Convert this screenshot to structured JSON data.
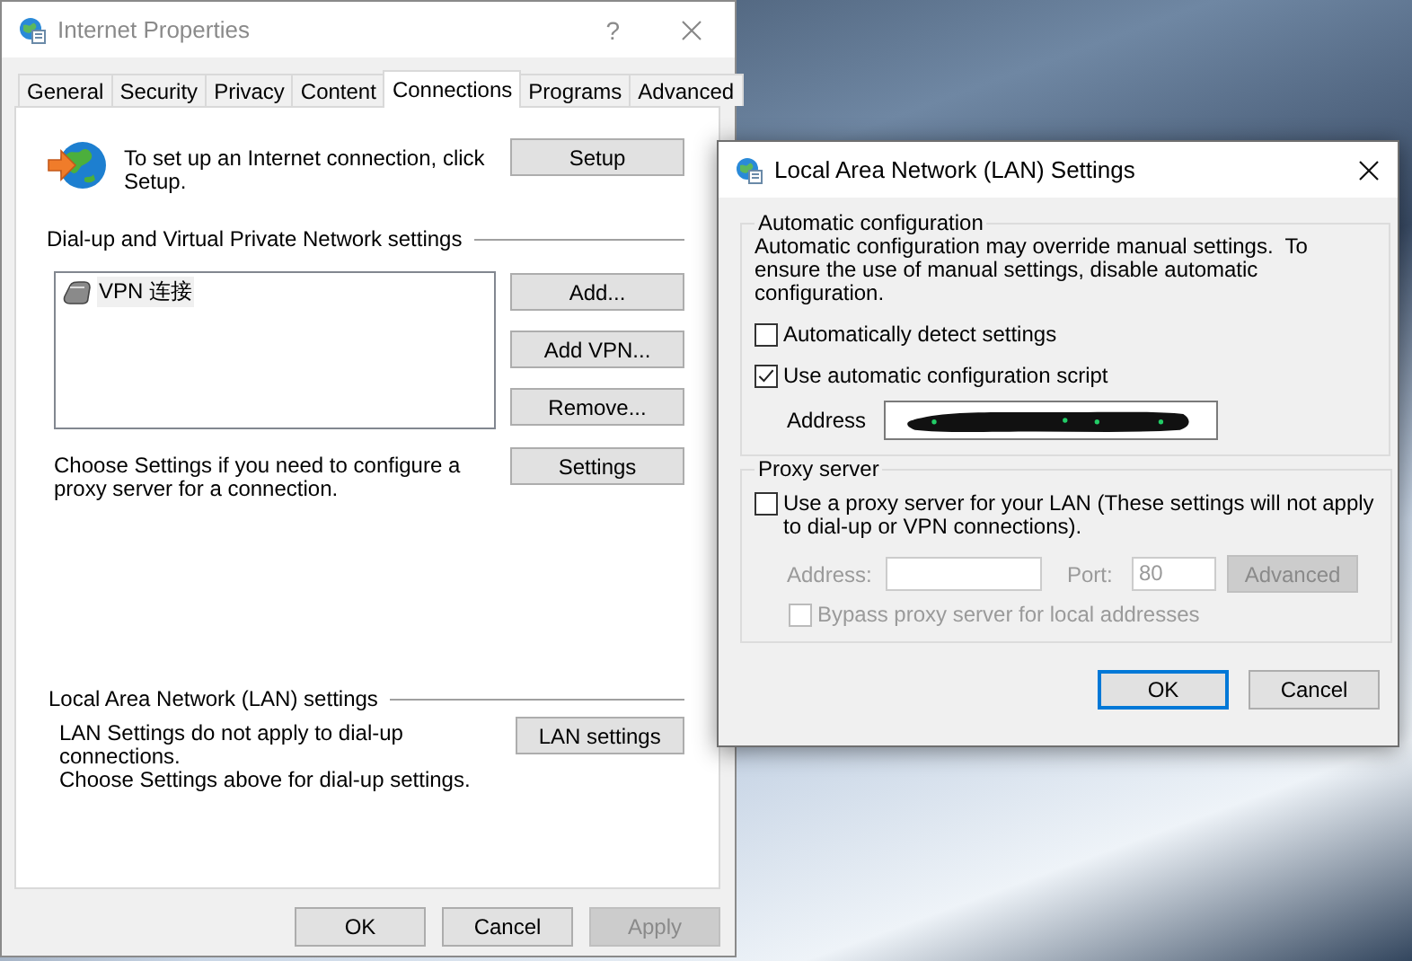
{
  "internet_properties": {
    "title": "Internet Properties",
    "help": "?",
    "tabs": [
      {
        "label": "General",
        "selected": false
      },
      {
        "label": "Security",
        "selected": false
      },
      {
        "label": "Privacy",
        "selected": false
      },
      {
        "label": "Content",
        "selected": false
      },
      {
        "label": "Connections",
        "selected": true
      },
      {
        "label": "Programs",
        "selected": false
      },
      {
        "label": "Advanced",
        "selected": false
      }
    ],
    "setup": {
      "text": "To set up an Internet connection, click Setup.",
      "button": "Setup"
    },
    "dialup": {
      "heading": "Dial-up and Virtual Private Network settings",
      "connections": [
        {
          "name": "VPN 连接",
          "selected": true
        }
      ],
      "buttons": [
        "Add...",
        "Add VPN...",
        "Remove..."
      ],
      "proxy_note": "Choose Settings if you need to configure a proxy server for a connection.",
      "settings_button": "Settings"
    },
    "lan": {
      "heading": "Local Area Network (LAN) settings",
      "note_lines": [
        "LAN Settings do not apply to dial-up connections.",
        "Choose Settings above for dial-up settings."
      ],
      "button": "LAN settings"
    },
    "footer_buttons": [
      {
        "label": "OK",
        "disabled": false
      },
      {
        "label": "Cancel",
        "disabled": false
      },
      {
        "label": "Apply",
        "disabled": true
      }
    ]
  },
  "lan_dialog": {
    "title": "Local Area Network (LAN) Settings",
    "auto_config": {
      "heading": "Automatic configuration",
      "description": "Automatic configuration may override manual settings.  To ensure the use of manual settings, disable automatic configuration.",
      "options": [
        {
          "label": "Automatically detect settings",
          "checked": false
        },
        {
          "label": "Use automatic configuration script",
          "checked": true
        }
      ],
      "address_label": "Address",
      "address_redacted": true
    },
    "proxy": {
      "heading": "Proxy server",
      "disabled": true,
      "use_proxy": {
        "label": "Use a proxy server for your LAN (These settings will not apply to dial-up or VPN connections).",
        "checked": false
      },
      "address_label": "Address:",
      "port_label": "Port:",
      "port_value": "80",
      "advanced_button": "Advanced",
      "bypass": {
        "label": "Bypass proxy server for local addresses",
        "checked": false
      }
    },
    "buttons": [
      {
        "label": "OK",
        "default": true
      },
      {
        "label": "Cancel",
        "default": false
      }
    ]
  }
}
